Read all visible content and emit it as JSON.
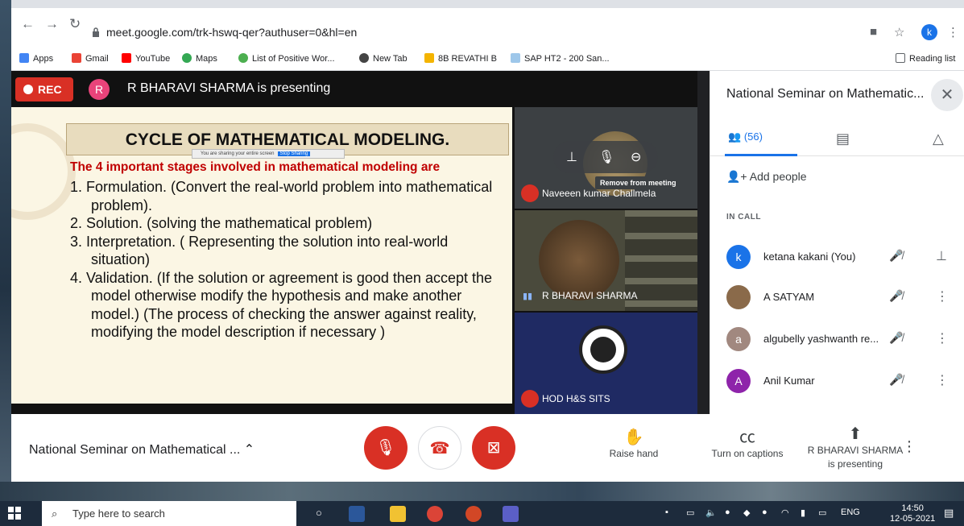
{
  "browser": {
    "url": "meet.google.com/trk-hswq-qer?authuser=0&hl=en",
    "profile_initial": "k",
    "bookmarks": [
      "Apps",
      "Gmail",
      "YouTube",
      "Maps",
      "List of Positive Wor...",
      "New Tab",
      "8B REVATHI B",
      "SAP HT2 - 200 San..."
    ],
    "reading_list": "Reading list"
  },
  "meet": {
    "rec_label": "REC",
    "presenter_initial": "R",
    "presenting_text": "R BHARAVI SHARMA is presenting",
    "slide": {
      "title": "CYCLE OF MATHEMATICAL MODELING.",
      "share_bar_text": "You are sharing your entire screen",
      "share_bar_stop": "Stop Sharing",
      "subtitle": "The 4 important stages involved in mathematical modeling are",
      "items": [
        "1. Formulation.  (Convert the real-world problem into mathematical problem).",
        "2. Solution. (solving the mathematical problem)",
        "3. Interpretation. ( Representing the solution into real-world situation)",
        "4. Validation. (If the solution or agreement is good then accept the model otherwise modify the hypothesis and make another model.) (The process of checking the answer against reality, modifying the model description if necessary )"
      ]
    },
    "tiles": [
      {
        "name": "Naveeen kumar Challmela",
        "tooltip": "Remove from meeting"
      },
      {
        "name": "R BHARAVI SHARMA"
      },
      {
        "name": "HOD H&S SITS"
      }
    ],
    "panel": {
      "title": "National Seminar on Mathematic...",
      "people_count": "(56)",
      "add_people": "Add people",
      "in_call": "IN CALL",
      "people": [
        {
          "initial": "k",
          "name": "ketana kakani (You)",
          "color": "#1a73e8"
        },
        {
          "initial": "",
          "name": "A SATYAM",
          "color": "#8a6a4a"
        },
        {
          "initial": "a",
          "name": "algubelly yashwanth re...",
          "color": "#a1887f"
        },
        {
          "initial": "A",
          "name": "Anil Kumar",
          "color": "#8e24aa"
        }
      ]
    },
    "bottom": {
      "meeting_name": "National Seminar on Mathematical ...",
      "raise_hand": "Raise hand",
      "captions": "Turn on captions",
      "presenting_line1": "R BHARAVI SHARMA",
      "presenting_line2": "is presenting"
    }
  },
  "taskbar": {
    "search_placeholder": "Type here to search",
    "lang": "ENG",
    "time": "14:50",
    "date": "12-05-2021"
  }
}
